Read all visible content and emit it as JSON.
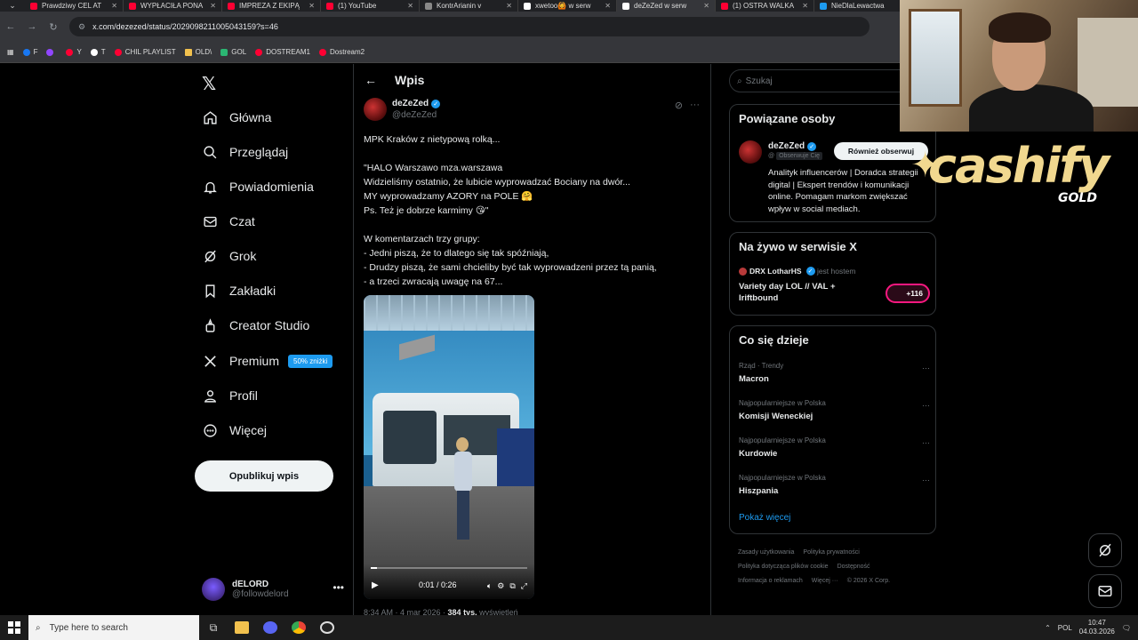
{
  "browser": {
    "tabs": [
      {
        "title": "Prawdziwy CEL AT",
        "color": "#ff0033"
      },
      {
        "title": "WYPŁACIŁA PONA",
        "color": "#ff0033"
      },
      {
        "title": "IMPREZA Z EKIPĄ",
        "color": "#ff0033"
      },
      {
        "title": "(1) YouTube",
        "color": "#ff0033"
      },
      {
        "title": "KontrArianin v",
        "color": "#888888"
      },
      {
        "title": "xwetoo🙆 w serw",
        "color": "#ffffff"
      },
      {
        "title": "deZeZed w serw",
        "color": "#ffffff",
        "active": true
      },
      {
        "title": "(1) OSTRA WALKA",
        "color": "#ff0033"
      },
      {
        "title": "NieDlaLewactwa",
        "color": "#1d9bf0"
      }
    ],
    "url": "x.com/dezezed/status/2029098211005043159?s=46",
    "bookmarks": [
      {
        "label": "F",
        "color": "#1877f2"
      },
      {
        "label": "",
        "color": "#9146ff"
      },
      {
        "label": "Y",
        "color": "#ff0033"
      },
      {
        "label": "T",
        "color": "#ffffff"
      },
      {
        "label": "CHIL PLAYLIST",
        "color": "#ff0033"
      },
      {
        "label": "OLD\\",
        "color": "#f2c14e"
      },
      {
        "label": "GOL",
        "color": "#2bb673"
      },
      {
        "label": "DOSTREAM1",
        "color": "#ff0033"
      },
      {
        "label": "Dostream2",
        "color": "#ff0033"
      }
    ]
  },
  "nav": {
    "items": [
      {
        "label": "Główna",
        "icon": "home-icon"
      },
      {
        "label": "Przeglądaj",
        "icon": "search-icon"
      },
      {
        "label": "Powiadomienia",
        "icon": "bell-icon"
      },
      {
        "label": "Czat",
        "icon": "mail-icon"
      },
      {
        "label": "Grok",
        "icon": "grok-icon"
      },
      {
        "label": "Zakładki",
        "icon": "bookmark-icon"
      },
      {
        "label": "Creator Studio",
        "icon": "creator-icon"
      },
      {
        "label": "Premium",
        "icon": "x-icon",
        "badge": "50% zniżki"
      },
      {
        "label": "Profil",
        "icon": "person-icon"
      },
      {
        "label": "Więcej",
        "icon": "more-icon"
      }
    ],
    "post_button": "Opublikuj wpis",
    "account": {
      "name": "dELORD",
      "handle": "@followdelord"
    }
  },
  "post": {
    "header": "Wpis",
    "author_name": "deZeZed",
    "author_handle": "@deZeZed",
    "text": "MPK Kraków z nietypową rolką...\n\n\"HALO Warszawo mza.warszawa\nWidzieliśmy ostatnio, że lubicie wyprowadzać Bociany na dwór...\nMY wyprowadzamy AZORY na POLE 🤗\nPs. Też je dobrze karmimy 😘\"\n\nW komentarzach trzy grupy:\n- Jedni piszą, że to dlatego się tak spóźniają,\n- Drudzy piszą, że sami chcieliby być tak wyprowadzeni przez tą panią,\n- a trzeci zwracają uwagę na 67...",
    "video": {
      "time": "0:01 / 0:26",
      "progress": 0.04
    },
    "meta": {
      "time": "8:34 AM · 4 mar 2026 · ",
      "views": "384 tys.",
      "views_label": " wyświetleń"
    }
  },
  "right": {
    "search_placeholder": "Szukaj",
    "related": {
      "title": "Powiązane osoby",
      "name": "deZeZed",
      "follows_you": "Obserwuje Cię",
      "follow_button": "Również obserwuj",
      "bio": "Analityk influencerów | Doradca strategii digital | Ekspert trendów i komunikacji online. Pomagam markom zwiększać wpływ w social mediach."
    },
    "live": {
      "title": "Na żywo w serwisie X",
      "host": "DRX LotharHS",
      "host_label": "jest hostem",
      "stream_title": "Variety day LOL // VAL + Iriftbound",
      "count": "+116"
    },
    "trends": {
      "title": "Co się dzieje",
      "items": [
        {
          "context": "Rząd · Trendy",
          "name": "Macron"
        },
        {
          "context": "Najpopularniejsze w Polska",
          "name": "Komisji Weneckiej"
        },
        {
          "context": "Najpopularniejsze w Polska",
          "name": "Kurdowie"
        },
        {
          "context": "Najpopularniejsze w Polska",
          "name": "Hiszpania"
        }
      ],
      "show_more": "Pokaż więcej"
    },
    "footer": {
      "l1": "Zasady użytkowania",
      "l2": "Polityka prywatności",
      "l3": "Polityka dotycząca plików cookie",
      "l4": "Dostępność",
      "l5": "Informacja o reklamach",
      "l6": "Więcej ···",
      "l7": "© 2026 X Corp."
    }
  },
  "overlay": {
    "brand": "cashify",
    "brand_sub": "GOLD"
  },
  "taskbar": {
    "search": "Type here to search",
    "lang": "POL",
    "time": "10:47",
    "date": "04.03.2026"
  }
}
